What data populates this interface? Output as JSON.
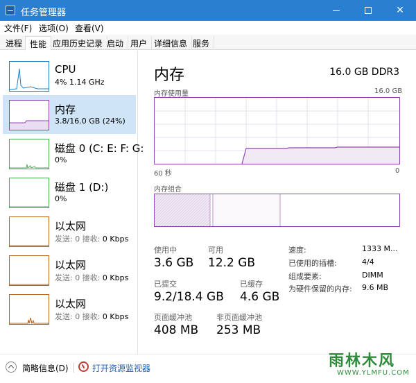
{
  "window": {
    "title": "任务管理器"
  },
  "menu": [
    "文件(F)",
    "选项(O)",
    "查看(V)"
  ],
  "tabs": [
    "进程",
    "性能",
    "应用历史记录",
    "启动",
    "用户",
    "详细信息",
    "服务"
  ],
  "active_tab": "性能",
  "sidebar": {
    "items": [
      {
        "title": "CPU",
        "sub": "4% 1.14 GHz",
        "sub_muted": "",
        "color": "#1f7fc4",
        "icon": "cpu-graph-icon"
      },
      {
        "title": "内存",
        "sub": "3.8/16.0 GB (24%)",
        "sub_muted": "",
        "color": "#8e44ad",
        "icon": "memory-graph-icon"
      },
      {
        "title": "磁盘 0 (C: E: F: G:",
        "sub": "0%",
        "sub_muted": "",
        "color": "#4caf50",
        "icon": "disk-graph-icon"
      },
      {
        "title": "磁盘 1 (D:)",
        "sub": "0%",
        "sub_muted": "",
        "color": "#4caf50",
        "icon": "disk-graph-icon"
      },
      {
        "title": "以太网",
        "sub": "0 Kbps",
        "sub_muted": "发送: 0 接收:",
        "color": "#b5651d",
        "icon": "network-graph-icon"
      },
      {
        "title": "以太网",
        "sub": "0 Kbps",
        "sub_muted": "发送: 0 接收:",
        "color": "#b5651d",
        "icon": "network-graph-icon"
      },
      {
        "title": "以太网",
        "sub": "0 Kbps",
        "sub_muted": "发送: 0 接收:",
        "color": "#b5651d",
        "icon": "network-graph-icon"
      }
    ]
  },
  "main": {
    "title": "内存",
    "spec": "16.0 GB DDR3",
    "usage_chart_label": "内存使用量",
    "usage_chart_max": "16.0 GB",
    "time_left": "60 秒",
    "time_right": "0",
    "composition_label": "内存组合",
    "accent": "#8e44ad",
    "stats": {
      "in_use_label": "使用中",
      "in_use": "3.6 GB",
      "available_label": "可用",
      "available": "12.2 GB",
      "committed_label": "已提交",
      "committed": "9.2/18.4 GB",
      "cached_label": "已缓存",
      "cached": "4.6 GB",
      "paged_label": "页面缓冲池",
      "paged": "408 MB",
      "nonpaged_label": "非页面缓冲池",
      "nonpaged": "253 MB"
    },
    "details": [
      {
        "label": "速度:",
        "value": "1333 M..."
      },
      {
        "label": "已使用的插槽:",
        "value": "4/4"
      },
      {
        "label": "组成要素:",
        "value": "DIMM"
      },
      {
        "label": "为硬件保留的内存:",
        "value": "9.6 MB"
      }
    ]
  },
  "bottom": {
    "fewer_details": "简略信息(D)",
    "open_monitor": "打开资源监视器"
  },
  "logo": {
    "text": "雨林木风",
    "url": "WWW.YLMFU.COM"
  }
}
